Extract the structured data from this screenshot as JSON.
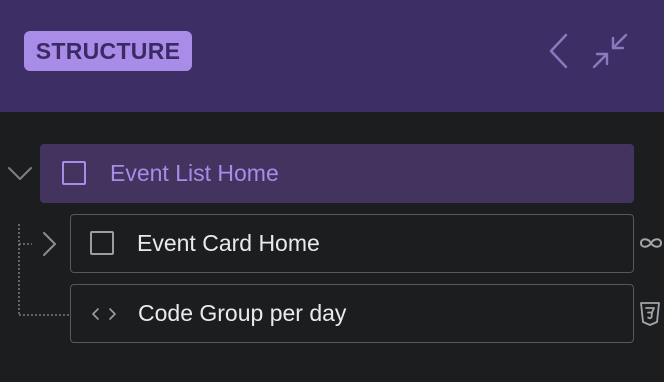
{
  "panel": {
    "title": "STRUCTURE"
  },
  "header_icons": {
    "collapse": "chevron-left-icon",
    "minimize": "arrows-in-icon"
  },
  "tree": {
    "root": {
      "label": "Event List Home",
      "icon": "square-icon",
      "expanded": true
    },
    "children": [
      {
        "label": "Event Card Home",
        "icon": "square-icon",
        "expanded": false,
        "badge_icon": "infinity-icon"
      },
      {
        "label": "Code Group per day",
        "icon": "code-icon",
        "badge_icon": "css3-icon"
      }
    ]
  },
  "colors": {
    "header_bg": "#3d2e66",
    "accent": "#a98be8",
    "selected_row_bg": "#42335f",
    "panel_bg": "#1b1d1f"
  }
}
